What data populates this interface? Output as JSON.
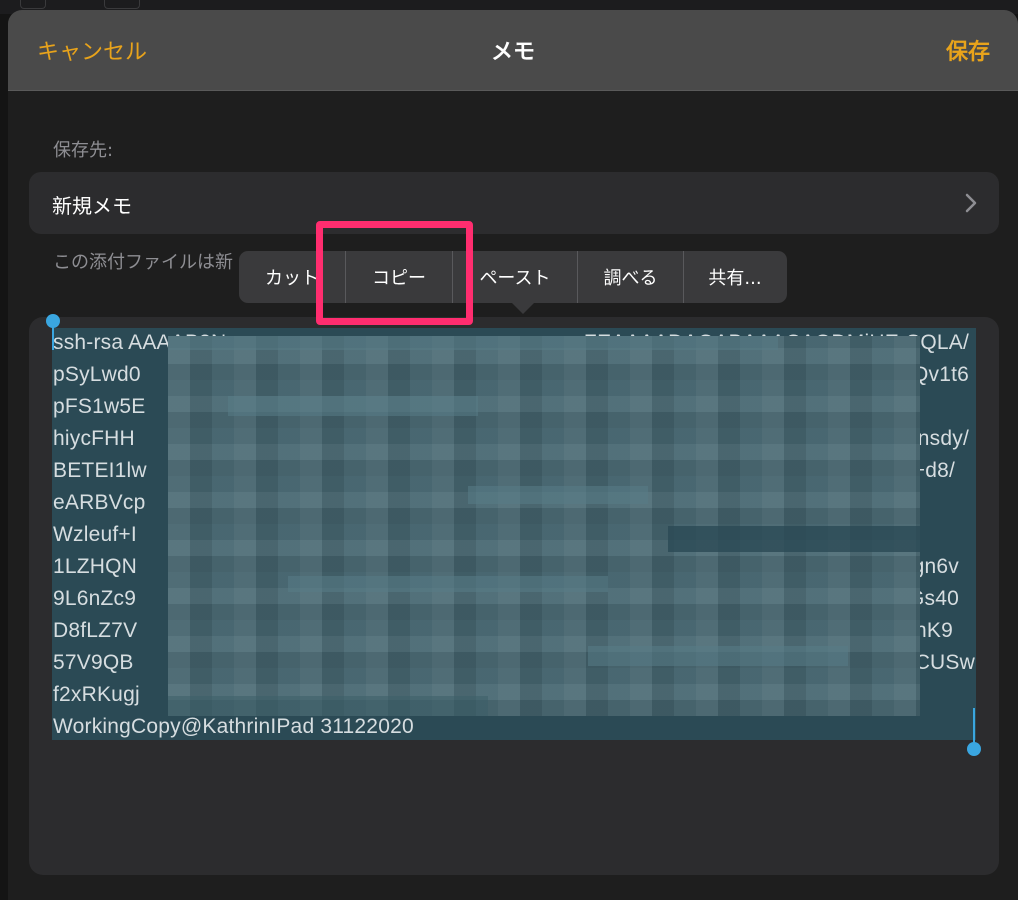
{
  "nav": {
    "cancel_label": "キャンセル",
    "title": "メモ",
    "save_label": "保存"
  },
  "destination": {
    "label": "保存先:",
    "value": "新規メモ"
  },
  "note_text": "この添付ファイルは新",
  "context_menu": {
    "items": [
      "カット",
      "コピー",
      "ペースト",
      "調べる",
      "共有..."
    ]
  },
  "key_text": {
    "lines_left": [
      "ssh-rsa AAAAB3N",
      "pSyLwd0",
      "pFS1w5E",
      "hiycFHH",
      "BETEI1lw",
      "eARBVcp",
      "Wzleuf+I",
      "1LZHQN",
      "9L6nZc9",
      "D8fLZ7V",
      "57V9QB",
      "f2xRKugj",
      "WorkingCopy@KathrinIPad  31122020"
    ],
    "lines_right": [
      "ZEAAAADAQABAAACAQDMiHE-SQLA/",
      "IQv1t6",
      "",
      "Fnsdy/",
      "I+d8/",
      "/",
      "",
      "dgn6v",
      "DGs40",
      "mnK9",
      "GCUSw",
      "",
      ""
    ]
  },
  "colors": {
    "accent": "#e8a31b",
    "selection_handle": "#3aa6e0",
    "highlight_box": "#ff2d6f"
  }
}
